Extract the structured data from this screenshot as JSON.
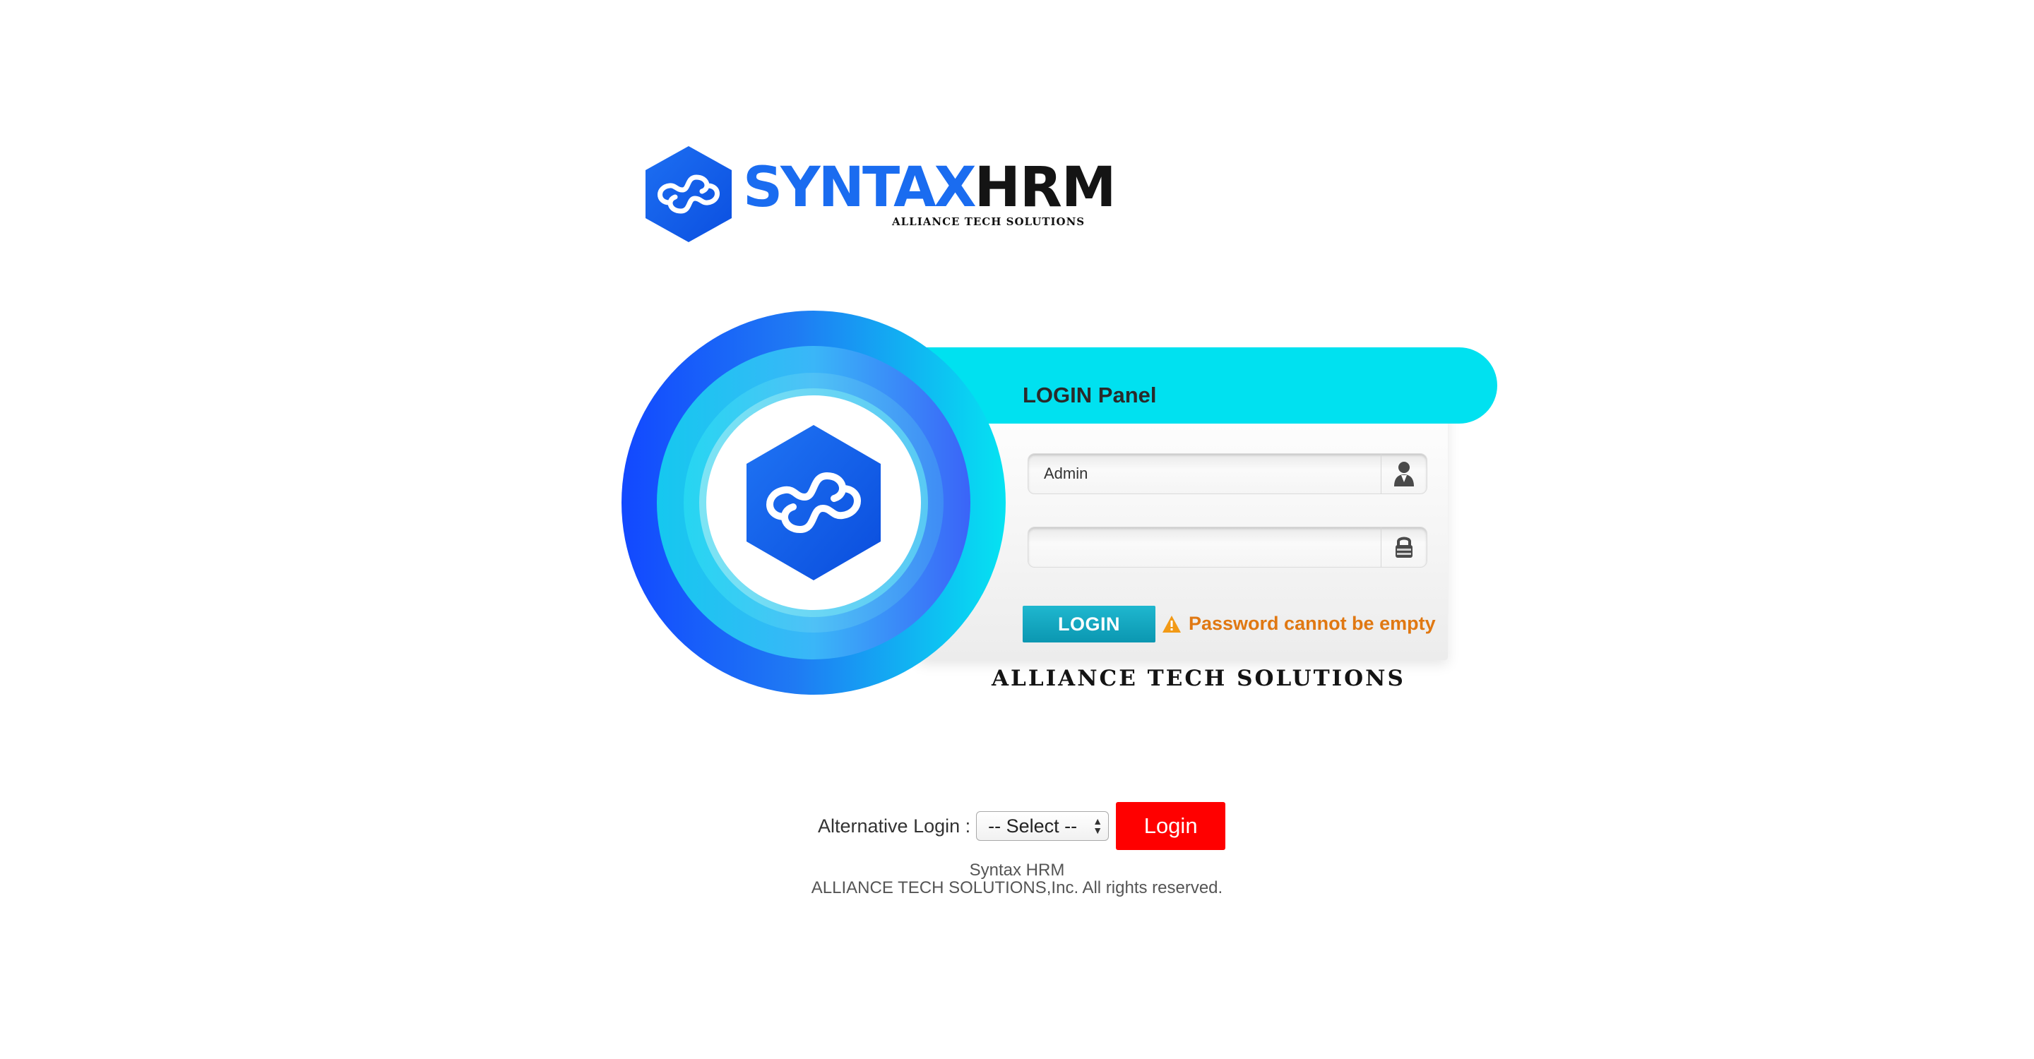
{
  "logo": {
    "brand_part1": "SYNTAX",
    "brand_part2": "HRM",
    "tagline": "ALLIANCE TECH SOLUTIONS",
    "icon": "syntax-hexagon-logo-icon"
  },
  "login_panel": {
    "title": "LOGIN Panel",
    "username": {
      "value": "Admin",
      "icon": "user-icon"
    },
    "password": {
      "value": "",
      "icon": "lock-icon"
    },
    "login_button": "LOGIN",
    "error": {
      "icon": "warning-icon",
      "message": "Password cannot be empty"
    },
    "company_caption": "ALLIANCE TECH SOLUTIONS"
  },
  "alternative_login": {
    "label": "Alternative Login :",
    "select_value": "-- Select --",
    "button": "Login"
  },
  "footer": {
    "line1": "Syntax HRM",
    "line2": "ALLIANCE TECH SOLUTIONS,Inc. All rights reserved."
  },
  "colors": {
    "brand_blue": "#1a6cf0",
    "panel_header": "#00e1f0",
    "login_button": "#0b97b1",
    "error_text": "#e07812",
    "alt_login_button": "#ff0000"
  }
}
